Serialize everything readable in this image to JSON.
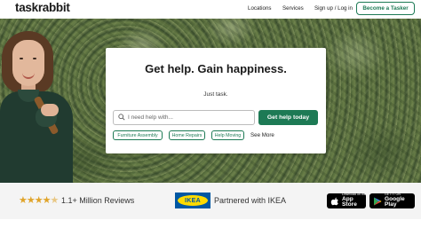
{
  "header": {
    "logo": "taskrabbit",
    "nav": [
      "Locations",
      "Services",
      "Sign up / Log in"
    ],
    "cta": "Become a Tasker"
  },
  "hero": {
    "headline": "Get help. Gain happiness.",
    "subline": "Just task.",
    "search": {
      "placeholder": "I need help with...",
      "value": ""
    },
    "search_button": "Get help today",
    "chips": [
      "Furniture Assembly",
      "Home Repairs",
      "Help Moving"
    ],
    "see_more": "See More"
  },
  "trust_bar": {
    "rating_stars": 4.5,
    "reviews": "1.1+ Million Reviews",
    "ikea_logo": "IKEA",
    "partner": "Partnered with IKEA",
    "app_store": {
      "small": "Download on the",
      "big": "App Store"
    },
    "google_play": {
      "small": "GET IT ON",
      "big": "Google Play"
    }
  },
  "colors": {
    "brand_green": "#1d7a55",
    "star": "#e0a42a",
    "ikea_blue": "#0058a3",
    "ikea_yellow": "#ffdb00"
  },
  "icons": [
    "search-icon",
    "star-icon",
    "apple-icon",
    "google-play-icon"
  ]
}
